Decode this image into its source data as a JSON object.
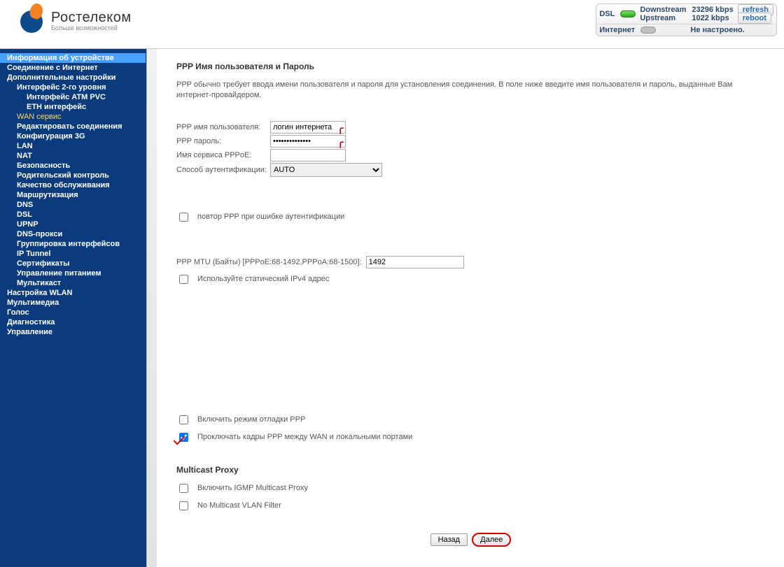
{
  "brand": {
    "title": "Ростелеком",
    "subtitle": "Больше возможностей"
  },
  "status": {
    "dsl_label": "DSL",
    "downstream_label": "Downstream",
    "downstream_value": "23296 kbps",
    "upstream_label": "Upstream",
    "upstream_value": "1022 kbps",
    "refresh_btn": "refresh",
    "reboot_btn": "reboot",
    "internet_label": "Интернет",
    "internet_value": "Не настроено."
  },
  "sidebar": {
    "items": [
      {
        "label": "Информация об устройстве",
        "lvl": 1,
        "sel": true
      },
      {
        "label": "Соединение с Интернет",
        "lvl": 1
      },
      {
        "label": "Дополнительные настройки",
        "lvl": 1
      },
      {
        "label": "Интерфейс 2-го уровня",
        "lvl": 2
      },
      {
        "label": "Интерфейс ATM PVC",
        "lvl": 3
      },
      {
        "label": "ETH интерфейс",
        "lvl": 3
      },
      {
        "label": "WAN сервис",
        "lvl": 2,
        "active": true
      },
      {
        "label": "Редактировать соединения",
        "lvl": 2
      },
      {
        "label": "Конфигурация 3G",
        "lvl": 2
      },
      {
        "label": "LAN",
        "lvl": 2
      },
      {
        "label": "NAT",
        "lvl": 2
      },
      {
        "label": "Безопасность",
        "lvl": 2
      },
      {
        "label": "Родительский контроль",
        "lvl": 2
      },
      {
        "label": "Качество обслуживания",
        "lvl": 2
      },
      {
        "label": "Маршрутизация",
        "lvl": 2
      },
      {
        "label": "DNS",
        "lvl": 2
      },
      {
        "label": "DSL",
        "lvl": 2
      },
      {
        "label": "UPNP",
        "lvl": 2
      },
      {
        "label": "DNS-прокси",
        "lvl": 2
      },
      {
        "label": "Группировка интерфейсов",
        "lvl": 2
      },
      {
        "label": "IP Tunnel",
        "lvl": 2
      },
      {
        "label": "Сертификаты",
        "lvl": 2
      },
      {
        "label": "Управление питанием",
        "lvl": 2
      },
      {
        "label": "Мультикаст",
        "lvl": 2
      },
      {
        "label": "Настройка WLAN",
        "lvl": 1
      },
      {
        "label": "Мультимедиа",
        "lvl": 1
      },
      {
        "label": "Голос",
        "lvl": 1
      },
      {
        "label": "Диагностика",
        "lvl": 1
      },
      {
        "label": "Управление",
        "lvl": 1
      }
    ]
  },
  "page": {
    "title": "PPP Имя пользователя и Пароль",
    "intro": "PPP обычно требует ввода имени пользователя и пароля для установления соединения. В поле ниже введите имя пользователя и пароль, выданные Вам интернет-провайдером.",
    "username_label": "PPP имя пользователя:",
    "username_value": "логин интернета",
    "password_label": "PPP пароль:",
    "password_value": "••••••••••••••",
    "service_label": "Имя сервиса PPPoE:",
    "service_value": "",
    "auth_label": "Способ аутентификации:",
    "auth_value": "AUTO",
    "retry_label": "повтор PPP при ошибке аутентификации",
    "mtu_label": "PPP MTU (Байты) [PPPoE:68-1492,PPPoA:68-1500]:",
    "mtu_value": "1492",
    "static_ipv4_label": "Используйте статический IPv4 адрес",
    "debug_label": "Включить режим отладки PPP",
    "bridge_label": "Проключать кадры PPP между WAN и локальными портами",
    "multicast_heading": "Multicast Proxy",
    "igmp_label": "Включить IGMP Multicast Proxy",
    "novlan_label": "No Multicast VLAN Filter",
    "back_btn": "Назад",
    "next_btn": "Далее"
  }
}
